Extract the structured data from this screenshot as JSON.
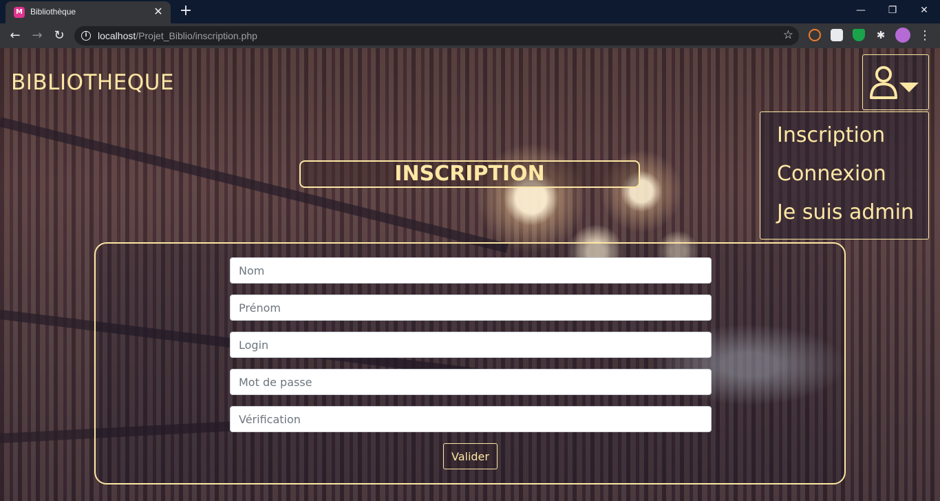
{
  "browser": {
    "tab_title": "Bibliothèque",
    "favicon_label": "M",
    "new_tab_symbol": "+",
    "url_host": "localhost",
    "url_path": "/Projet_Biblio/inscription.php"
  },
  "page": {
    "brand": "BIBLIOTHEQUE",
    "user_menu": {
      "items": [
        {
          "label": "Inscription"
        },
        {
          "label": "Connexion"
        },
        {
          "label": "Je suis admin"
        }
      ]
    },
    "heading": "INSCRIPTION",
    "form": {
      "fields": [
        {
          "placeholder": "Nom"
        },
        {
          "placeholder": "Prénom"
        },
        {
          "placeholder": "Login"
        },
        {
          "placeholder": "Mot de passe"
        },
        {
          "placeholder": "Vérification"
        }
      ],
      "submit_label": "Valider"
    }
  },
  "colors": {
    "accent": "#fde7a4",
    "chrome_dark": "#0d1a30",
    "toolbar": "#35363a"
  },
  "icons": [
    "info-icon",
    "star-icon",
    "user-icon",
    "caret-down-icon",
    "extensions-puzzle-icon",
    "kebab-menu-icon"
  ]
}
